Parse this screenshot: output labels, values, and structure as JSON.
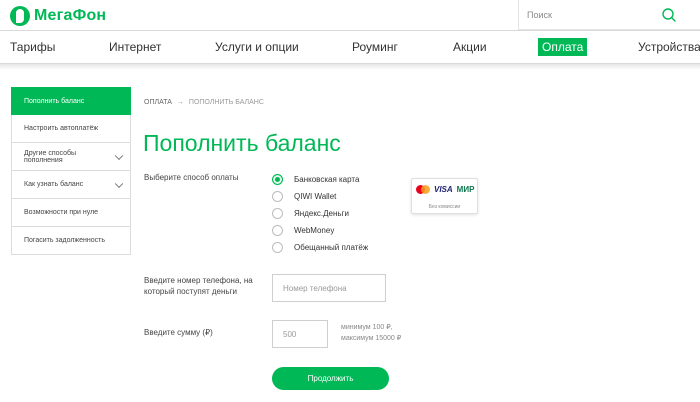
{
  "header": {
    "logo_text": "МегаФон",
    "search_placeholder": "Поиск",
    "icons": {
      "search": "search-icon",
      "logo": "megafon-logo-icon"
    }
  },
  "nav": {
    "items": [
      {
        "label": "Тарифы"
      },
      {
        "label": "Интернет"
      },
      {
        "label": "Услуги и опции"
      },
      {
        "label": "Роуминг"
      },
      {
        "label": "Акции"
      },
      {
        "label": "Оплата",
        "active": true
      },
      {
        "label": "Устройства"
      }
    ]
  },
  "sidebar": {
    "items": [
      {
        "label": "Пополнить баланс",
        "active": true
      },
      {
        "label": "Настроить автоплатёж"
      },
      {
        "label": "Другие способы пополнения",
        "has_submenu": true
      },
      {
        "label": "Как узнать баланс",
        "has_submenu": true
      },
      {
        "label": "Возможности при нуле"
      },
      {
        "label": "Погасить задолженность"
      }
    ]
  },
  "breadcrumb": {
    "items": [
      "ОПЛАТА",
      "ПОПОЛНИТЬ БАЛАНС"
    ],
    "separator": "→"
  },
  "page": {
    "title": "Пополнить баланс"
  },
  "payment": {
    "method_label": "Выберите способ оплаты",
    "methods": [
      {
        "label": "Банковская карта",
        "selected": true
      },
      {
        "label": "QIWI Wallet"
      },
      {
        "label": "Яндекс.Деньги"
      },
      {
        "label": "WebMoney"
      },
      {
        "label": "Обещанный платёж"
      }
    ],
    "card_badge": {
      "logos": [
        "mastercard-icon",
        "VISA",
        "МИР"
      ],
      "note": "Без комиссии"
    },
    "phone_label": "Введите номер телефона, на который поступят деньги",
    "phone_placeholder": "Номер телефона",
    "amount_label": "Введите сумму (₽)",
    "amount_placeholder": "500",
    "amount_hint_min": "минимум 100 ₽,",
    "amount_hint_max": "максимум 15000 ₽",
    "submit_label": "Продолжить"
  },
  "colors": {
    "brand": "#00b956",
    "text": "#333333",
    "border": "#dcdcdc"
  }
}
